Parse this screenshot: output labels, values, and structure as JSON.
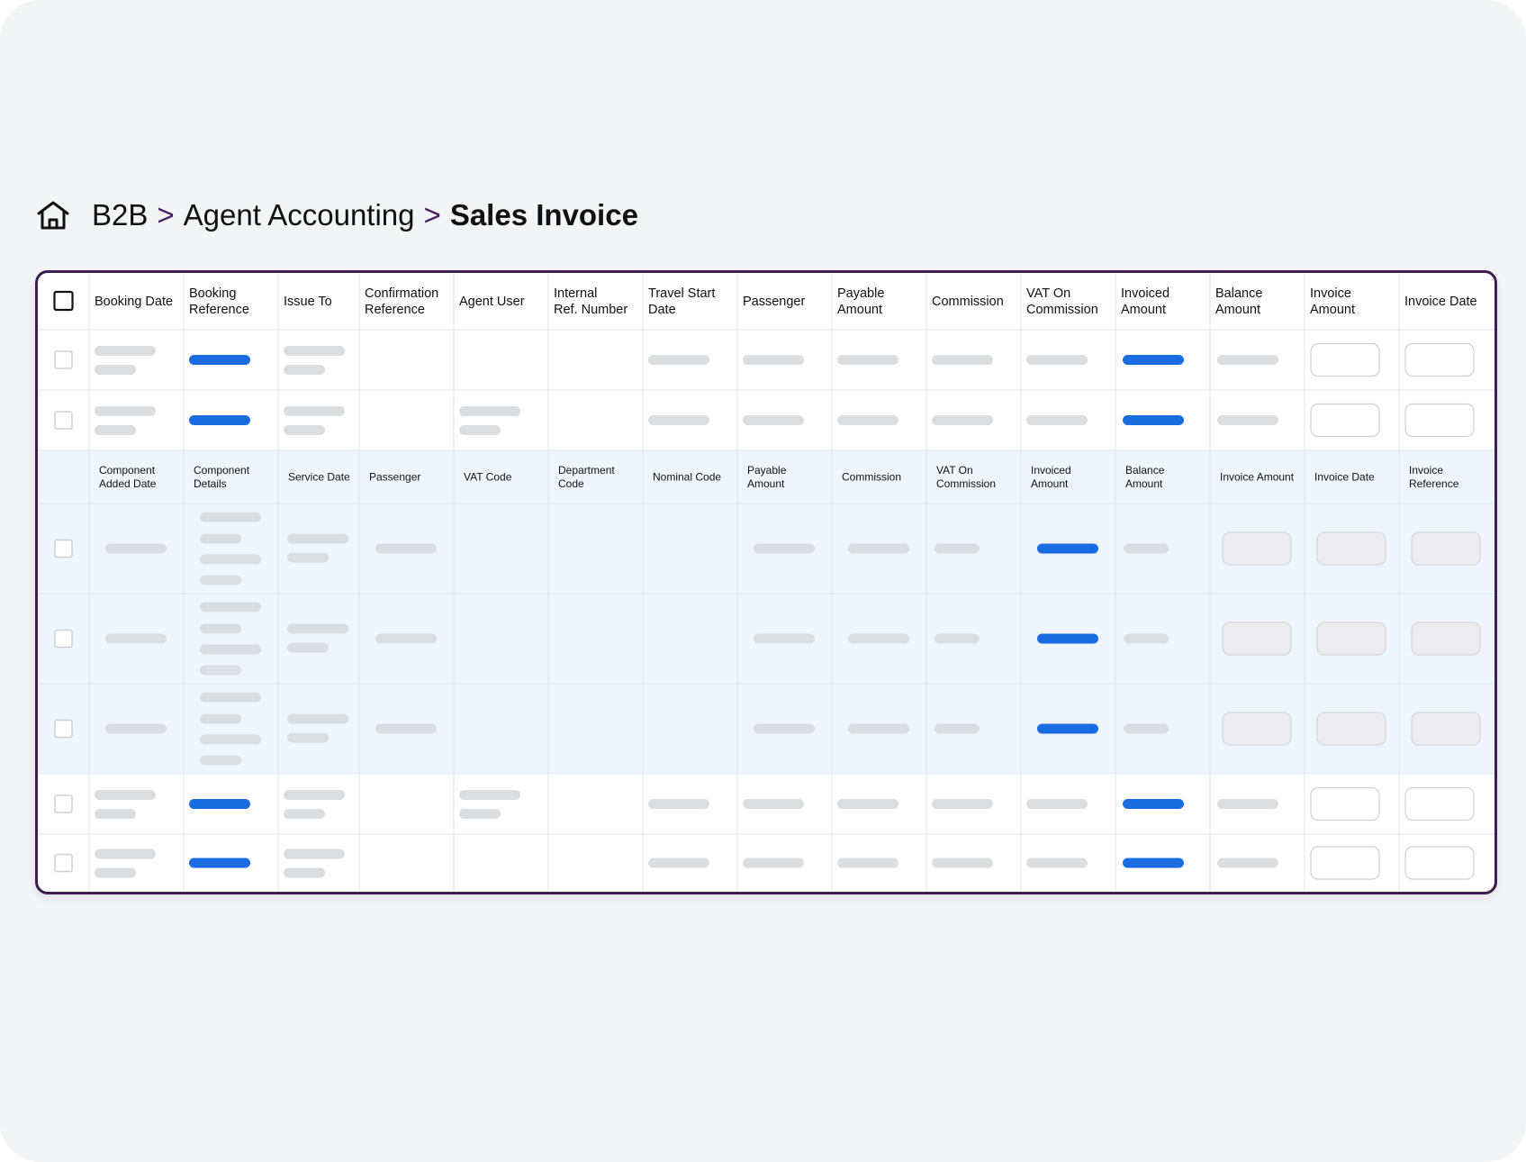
{
  "breadcrumb": {
    "home_icon": "home-icon",
    "items": [
      "B2B",
      "Agent Accounting",
      "Sales Invoice"
    ],
    "separator": ">"
  },
  "table": {
    "columns": [
      "Booking Date",
      "Booking Reference",
      "Issue To",
      "Confirmation Reference",
      "Agent User",
      "Internal Ref. Number",
      "Travel Start Date",
      "Passenger",
      "Payable Amount",
      "Commission",
      "VAT On Commission",
      "Invoiced Amount",
      "Balance Amount",
      "Invoice Amount",
      "Invoice Date"
    ],
    "sub_columns": [
      "Component Added Date",
      "Component Details",
      "Service Date",
      "Passenger",
      "VAT Code",
      "Department Code",
      "Nominal Code",
      "Payable Amount",
      "Commission",
      "VAT On Commission",
      "Invoiced Amount",
      "Balance Amount",
      "Invoice Amount",
      "Invoice Date",
      "Invoice Reference"
    ]
  },
  "colors": {
    "accent": "#1a6de0",
    "frame": "#3b1d4f",
    "placeholder": "#dcdde1",
    "subrow_bg": "#eff5fd"
  }
}
